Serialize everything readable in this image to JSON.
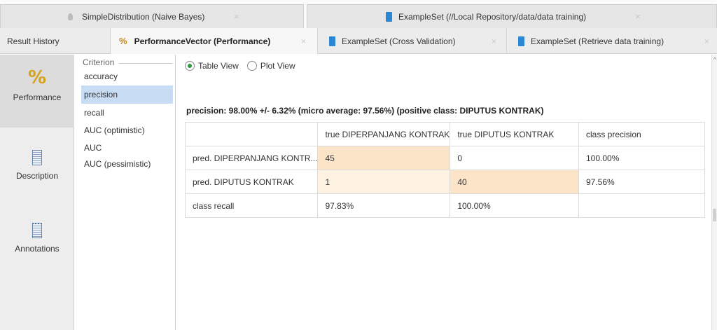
{
  "top_tabs": [
    {
      "label": "SimpleDistribution (Naive Bayes)",
      "icon": "bulb-icon"
    },
    {
      "label": "ExampleSet (//Local Repository/data/data training)",
      "icon": "document-icon"
    }
  ],
  "result_tabs": {
    "history_label": "Result History",
    "tabs": [
      {
        "label": "PerformanceVector (Performance)",
        "active": true,
        "icon": "percent-icon"
      },
      {
        "label": "ExampleSet (Cross Validation)",
        "active": false,
        "icon": "document-icon"
      },
      {
        "label": "ExampleSet (Retrieve data training)",
        "active": false,
        "icon": "document-icon"
      }
    ],
    "close_glyph": "×"
  },
  "sidebar": {
    "items": [
      {
        "label": "Performance",
        "icon": "percent-icon",
        "active": true
      },
      {
        "label": "Description",
        "icon": "description-icon",
        "active": false
      },
      {
        "label": "Annotations",
        "icon": "annotations-icon",
        "active": false
      }
    ]
  },
  "criterion": {
    "legend": "Criterion",
    "items": [
      "accuracy",
      "precision",
      "recall",
      "AUC (optimistic)",
      "AUC",
      "AUC (pessimistic)"
    ],
    "selected": "precision"
  },
  "view_toggle": {
    "options": [
      "Table View",
      "Plot View"
    ],
    "selected": "Table View"
  },
  "summary": "precision: 98.00% +/- 6.32% (micro average: 97.56%) (positive class: DIPUTUS KONTRAK)",
  "table": {
    "header": [
      "",
      "true DIPERPANJANG KONTRAK",
      "true DIPUTUS KONTRAK",
      "class precision"
    ],
    "rows": [
      [
        "pred. DIPERPANJANG KONTR...",
        "45",
        "0",
        "100.00%"
      ],
      [
        "pred. DIPUTUS KONTRAK",
        "1",
        "40",
        "97.56%"
      ],
      [
        "class recall",
        "97.83%",
        "100.00%",
        ""
      ]
    ]
  },
  "colors": {
    "selected_criterion": "#c8dcf3",
    "cell_highlight_strong": "#fbe4c8",
    "cell_highlight_light": "#fdf1e1",
    "radio_selected": "#2a9a3a",
    "document_icon": "#2b86d6"
  }
}
